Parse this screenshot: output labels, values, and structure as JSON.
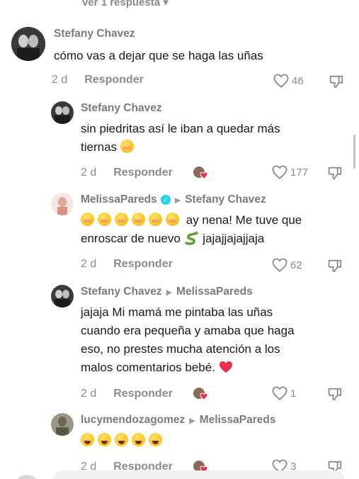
{
  "top_cut_label": "ver 1 respuesta ▾",
  "comments": [
    {
      "author": "Stefany Chavez",
      "text": "cómo vas a dejar que se haga las uñas",
      "time": "2 d",
      "reply": "Responder",
      "likes": "46"
    },
    {
      "author": "Stefany Chavez",
      "text_line1": "sin piedritas así le iban a quedar más",
      "text_line2": "tiernas",
      "time": "2 d",
      "reply": "Responder",
      "likes": "177"
    },
    {
      "author": "MelissaPareds",
      "reply_to": "Stefany Chavez",
      "text_line1": "ay nena! Me tuve que",
      "text_line2_a": "enroscar de nuevo",
      "text_line2_b": "jajajjajajjaja",
      "time": "2 d",
      "reply": "Responder",
      "likes": "62"
    },
    {
      "author": "Stefany Chavez",
      "reply_to": "MelissaPareds",
      "text_line1": "jajaja Mi mamá me pintaba las uñas",
      "text_line2": "cuando era pequeña y amaba que haga",
      "text_line3": "eso, no prestes mucha atención a los",
      "text_line4": "malos comentarios bebé.",
      "time": "2 d",
      "reply": "Responder",
      "likes": "1"
    },
    {
      "author": "lucymendozagomez",
      "reply_to": "MelissaPareds",
      "time": "2 d",
      "reply": "Responder",
      "likes": "3"
    }
  ],
  "colors": {
    "text": "#161823",
    "muted": "#8a8b91",
    "verified": "#20d5ec",
    "heart_red": "#e8304a"
  }
}
